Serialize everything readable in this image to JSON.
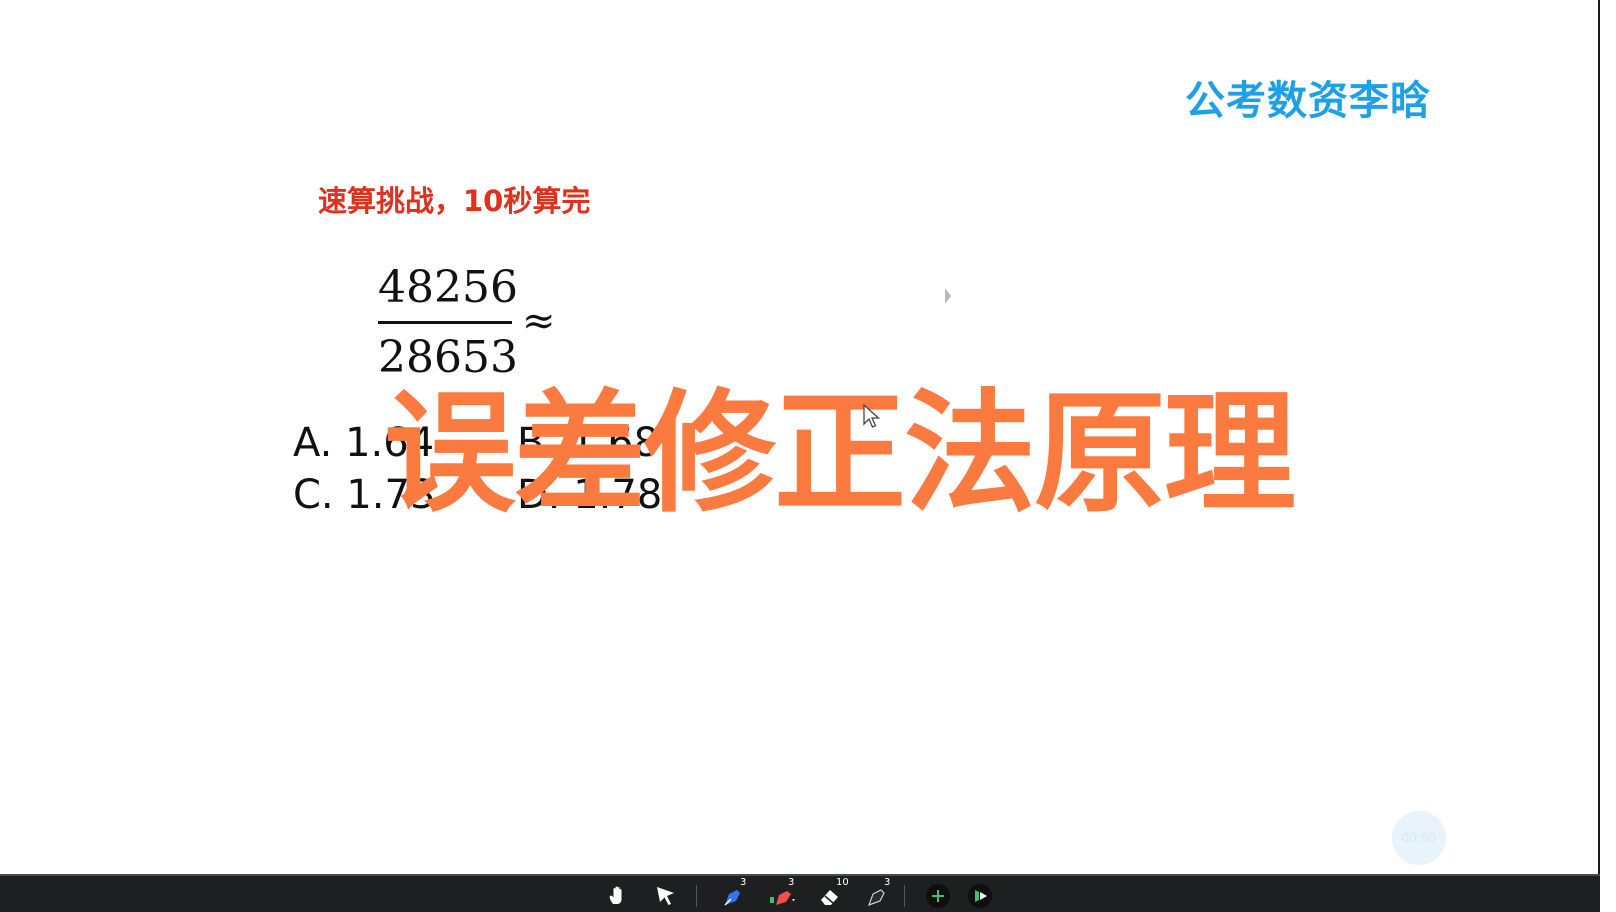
{
  "brand": {
    "text": "公考数资李晗",
    "color": "#1ea0e6"
  },
  "challenge": {
    "text": "速算挑战，10秒算完",
    "color": "#e0301e"
  },
  "question": {
    "numerator": "48256",
    "denominator": "28653",
    "approx_symbol": "≈",
    "options": [
      {
        "label": "A. 1.64"
      },
      {
        "label": "B. 1.68"
      },
      {
        "label": "C. 1.73"
      },
      {
        "label": "D. 1.78"
      }
    ]
  },
  "overlay": {
    "title": "误差修正法原理",
    "color": "#fb7a40"
  },
  "timer": {
    "text": "00:00"
  },
  "toolbar": {
    "tools": [
      {
        "name": "hand-icon"
      },
      {
        "name": "pointer-icon"
      },
      {
        "name": "blue-pen-icon",
        "count": "3"
      },
      {
        "name": "red-highlighter-icon",
        "count": "3"
      },
      {
        "name": "eraser-icon",
        "count": "10"
      },
      {
        "name": "black-pen-icon",
        "count": "3"
      },
      {
        "name": "add-icon"
      },
      {
        "name": "record-icon"
      }
    ]
  }
}
